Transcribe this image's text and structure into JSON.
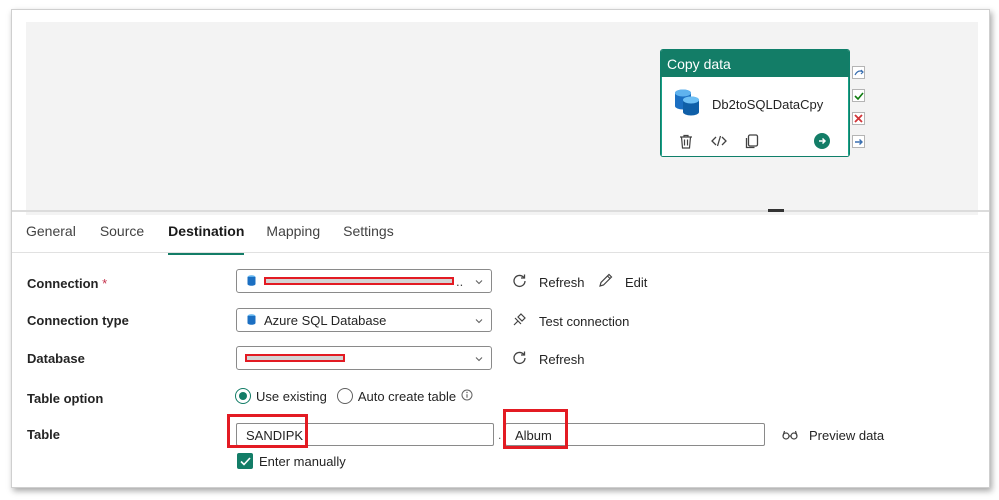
{
  "activity": {
    "type_label": "Copy data",
    "name": "Db2toSQLDataCpy",
    "tools": [
      "delete-icon",
      "code-icon",
      "copy-icon"
    ],
    "run_icon": "arrow-right-circle-icon",
    "ports": [
      "skip-icon",
      "success-check-icon",
      "failure-x-icon",
      "completion-arrow-icon"
    ]
  },
  "tabs": [
    {
      "label": "General",
      "active": false
    },
    {
      "label": "Source",
      "active": false
    },
    {
      "label": "Destination",
      "active": true
    },
    {
      "label": "Mapping",
      "active": false
    },
    {
      "label": "Settings",
      "active": false
    }
  ],
  "form": {
    "connection": {
      "label": "Connection",
      "required_mark": "*",
      "trailing_text": "..",
      "refresh_label": "Refresh",
      "edit_label": "Edit"
    },
    "connection_type": {
      "label": "Connection type",
      "value": "Azure SQL Database",
      "test_label": "Test connection"
    },
    "database": {
      "label": "Database",
      "refresh_label": "Refresh"
    },
    "table_option": {
      "label": "Table option",
      "options": [
        {
          "label": "Use existing",
          "selected": true
        },
        {
          "label": "Auto create table",
          "selected": false
        }
      ],
      "info_icon": "info-icon"
    },
    "table": {
      "label": "Table",
      "schema_value": "SANDIPK",
      "separator": ".",
      "name_value": "Album",
      "preview_label": "Preview data",
      "enter_manually_label": "Enter manually",
      "enter_manually_checked": true
    }
  },
  "colors": {
    "accent": "#137d67",
    "highlight_red": "#e31b23",
    "required_red": "#c4314b"
  }
}
